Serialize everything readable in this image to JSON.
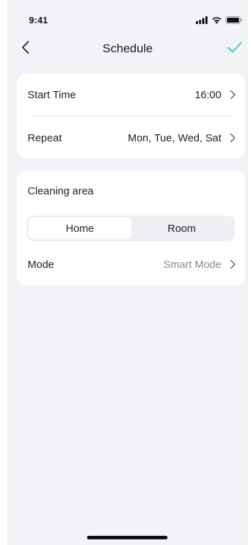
{
  "status_bar": {
    "time": "9:41",
    "icons": [
      "signal-icon",
      "wifi-icon",
      "battery-icon"
    ]
  },
  "nav": {
    "title": "Schedule",
    "back_icon": "chevron-left-icon",
    "confirm_icon": "checkmark-icon"
  },
  "schedule": {
    "start_time": {
      "label": "Start Time",
      "value": "16:00"
    },
    "repeat": {
      "label": "Repeat",
      "value": "Mon, Tue, Wed, Sat"
    }
  },
  "cleaning": {
    "title": "Cleaning area",
    "segments": [
      {
        "label": "Home",
        "selected": true
      },
      {
        "label": "Room",
        "selected": false
      }
    ],
    "mode": {
      "label": "Mode",
      "value": "Smart Mode"
    }
  },
  "colors": {
    "accent": "#3ec9c4",
    "background": "#f2f3f7",
    "card": "#ffffff",
    "muted_text": "#8a8a8e"
  }
}
